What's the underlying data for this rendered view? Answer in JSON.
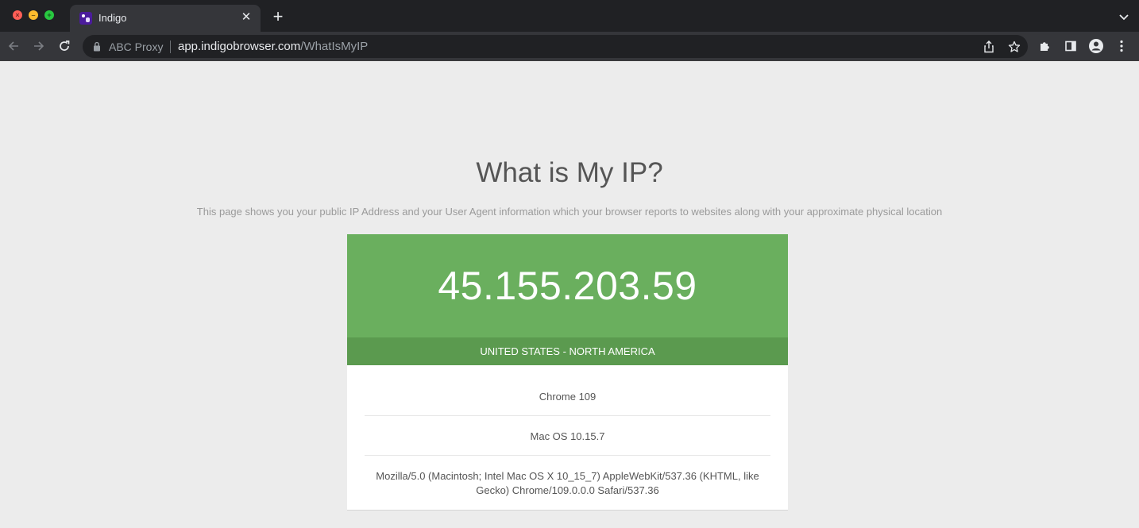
{
  "browser": {
    "tab_title": "Indigo",
    "proxy_label": "ABC Proxy",
    "url_host": "app.indigobrowser.com",
    "url_path": "/WhatIsMyIP"
  },
  "page": {
    "title": "What is My IP?",
    "subtitle": "This page shows you your public IP Address and your User Agent information which your browser reports to websites along with your approximate physical location",
    "ip": "45.155.203.59",
    "region": "UNITED STATES - NORTH AMERICA",
    "browser_name": "Chrome 109",
    "os": "Mac OS 10.15.7",
    "user_agent": "Mozilla/5.0 (Macintosh; Intel Mac OS X 10_15_7) AppleWebKit/537.36 (KHTML, like Gecko) Chrome/109.0.0.0 Safari/537.36"
  },
  "colors": {
    "ip_box": "#6aaf5e",
    "region_bar": "#5b9a4f",
    "tabbar": "#202124",
    "toolbar": "#35363a"
  },
  "icons": [
    "close-window-icon",
    "minimize-window-icon",
    "maximize-window-icon",
    "indigo-favicon-icon",
    "tab-close-icon",
    "new-tab-icon",
    "tab-search-icon",
    "back-arrow-icon",
    "forward-arrow-icon",
    "reload-icon",
    "lock-icon",
    "share-icon",
    "bookmark-star-icon",
    "extensions-puzzle-icon",
    "side-panel-icon",
    "profile-icon",
    "menu-kebab-icon"
  ]
}
